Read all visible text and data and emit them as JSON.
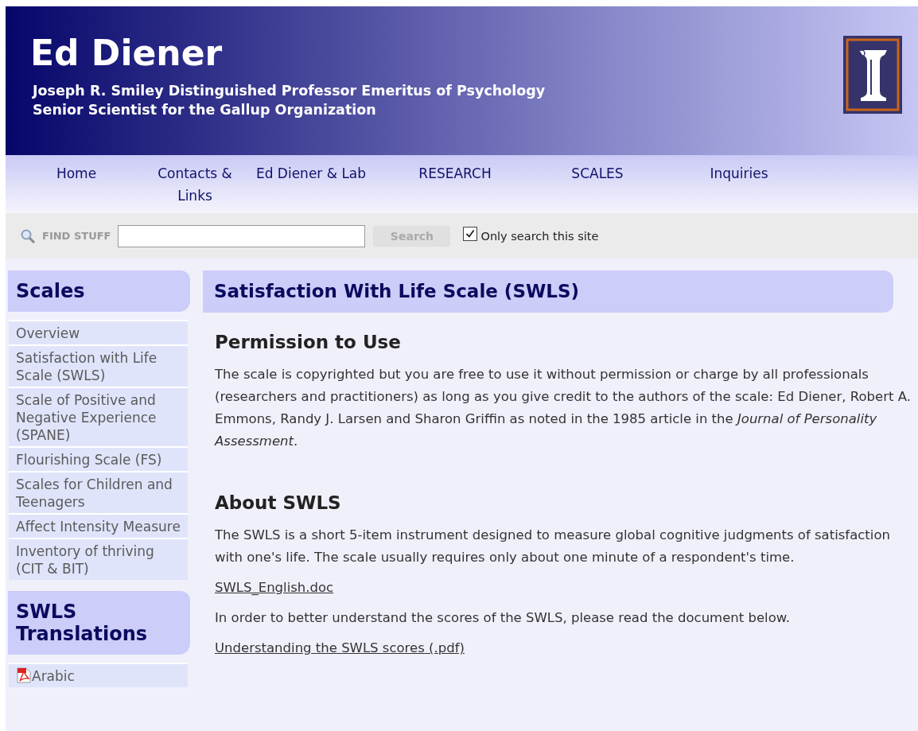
{
  "header": {
    "title": "Ed Diener",
    "subtitle_lines": [
      "Joseph R. Smiley Distinguished Professor Emeritus of Psychology",
      "Senior Scientist for the Gallup Organization"
    ]
  },
  "nav": [
    "Home",
    "Contacts & Links",
    "Ed Diener & Lab",
    "RESEARCH",
    "SCALES",
    "Inquiries"
  ],
  "search": {
    "label": "FIND STUFF",
    "button": "Search",
    "checkbox": {
      "label": "Only search this site",
      "checked": true
    }
  },
  "sidebar": [
    {
      "title": "Scales",
      "items": [
        {
          "label": "Overview",
          "kind": "link"
        },
        {
          "label": "Satisfaction with Life Scale (SWLS)",
          "kind": "link"
        },
        {
          "label": "Scale of Positive and Negative Experience (SPANE)",
          "kind": "link"
        },
        {
          "label": "Flourishing Scale (FS)",
          "kind": "link"
        },
        {
          "label": "Scales for Children and Teenagers",
          "kind": "link"
        },
        {
          "label": "Affect Intensity Measure",
          "kind": "link"
        },
        {
          "label": "Inventory of thriving (CIT & BIT)",
          "kind": "link"
        }
      ]
    },
    {
      "title": "SWLS Translations",
      "items": [
        {
          "label": "Arabic",
          "kind": "pdf"
        }
      ]
    }
  ],
  "content": {
    "title": "Satisfaction With Life Scale (SWLS)",
    "sections": [
      {
        "heading": "Permission to Use",
        "blocks": [
          {
            "kind": "text",
            "text": "The scale is copyrighted but you are free to use it without permission or charge by all professionals (researchers and practitioners) as long as you give credit to the authors of the scale: Ed Diener, Robert A. Emmons, Randy J. Larsen and Sharon Griffin as noted in the 1985 article in the *Journal of Personality Assessment*."
          }
        ]
      },
      {
        "heading": "About SWLS",
        "blocks": [
          {
            "kind": "text",
            "text": "The SWLS is a short 5-item instrument designed to measure global cognitive judgments of satisfaction with one's life. The scale usually requires only about one minute of a respondent's time."
          },
          {
            "kind": "link",
            "text": "SWLS_English.doc"
          },
          {
            "kind": "text",
            "text": "In order to better understand the scores of the SWLS, please read the document below."
          },
          {
            "kind": "link",
            "text": "Understanding the SWLS scores (.pdf)"
          }
        ]
      }
    ]
  }
}
